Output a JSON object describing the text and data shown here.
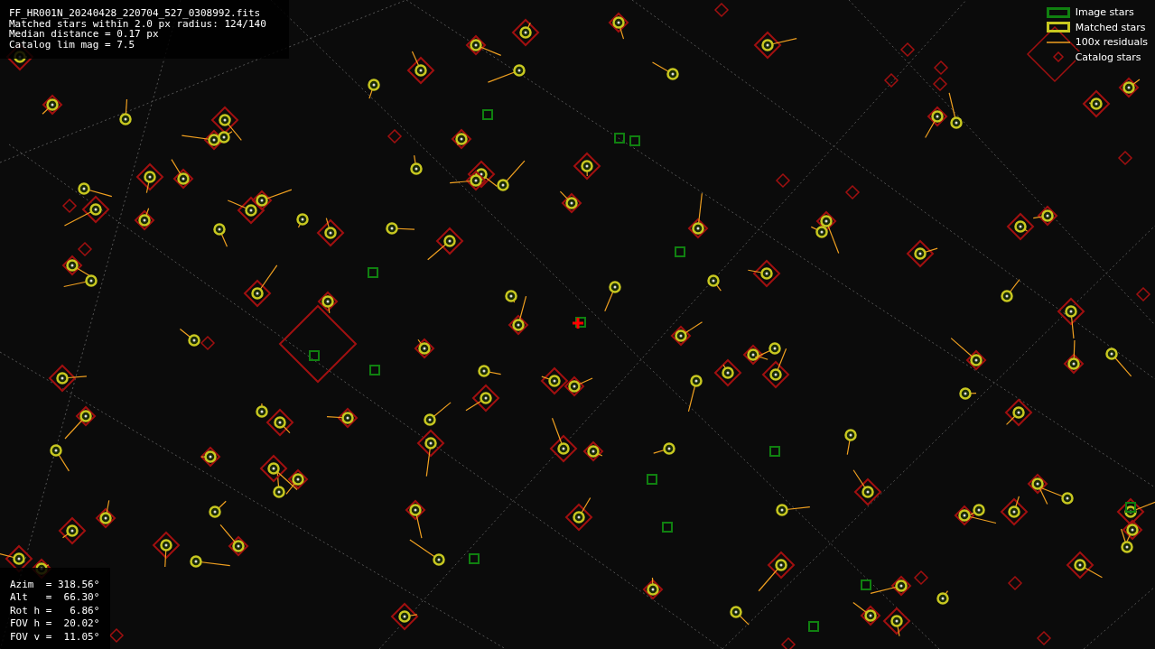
{
  "header_lines": [
    "FF_HR001N_20240428_220704_527_0308992.fits",
    "Matched stars within 2.0 px radius: 124/140",
    "Median distance = 0.17 px",
    "Catalog lim mag = 7.5"
  ],
  "legend": [
    {
      "label": "Image stars",
      "kind": "image"
    },
    {
      "label": "Matched stars",
      "kind": "matched"
    },
    {
      "label": "100x residuals",
      "kind": "residual"
    },
    {
      "label": "Catalog stars",
      "kind": "catalog"
    }
  ],
  "pointing_lines": [
    "Azim  = 318.56°",
    "Alt   =  66.30°",
    "Rot h =   6.86°",
    "FOV h =  20.02°",
    "FOV v =  11.05°"
  ]
}
